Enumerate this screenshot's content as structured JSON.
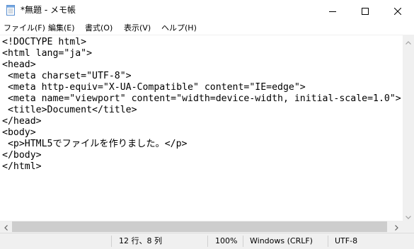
{
  "window": {
    "title": "*無題 - メモ帳",
    "icon": "notepad-icon",
    "controls": [
      "minimize-icon",
      "maximize-icon",
      "close-icon"
    ]
  },
  "menu": {
    "items": [
      {
        "label": "ファイル(F)"
      },
      {
        "label": "編集(E)"
      },
      {
        "label": "書式(O)"
      },
      {
        "label": "表示(V)"
      },
      {
        "label": "ヘルプ(H)"
      }
    ]
  },
  "editor": {
    "lines": [
      "<!DOCTYPE html>",
      "<html lang=\"ja\">",
      "<head>",
      " <meta charset=\"UTF-8\">",
      " <meta http-equiv=\"X-UA-Compatible\" content=\"IE=edge\">",
      " <meta name=\"viewport\" content=\"width=device-width, initial-scale=1.0\">",
      " <title>Document</title>",
      "</head>",
      "<body>",
      " <p>HTML5でファイルを作りました。</p>",
      "</body>",
      "</html>"
    ]
  },
  "status": {
    "position": "12 行、8 列",
    "zoom": "100%",
    "line_ending": "Windows (CRLF)",
    "encoding": "UTF-8"
  }
}
